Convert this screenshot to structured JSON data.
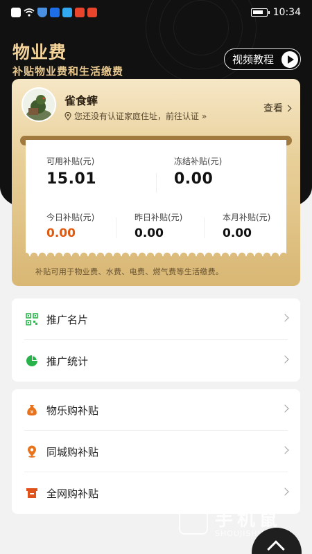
{
  "status_bar": {
    "time": "10:34",
    "icons": [
      "alert-icon",
      "wifi-icon",
      "shield-icon",
      "app-blue-icon",
      "app-sky-icon",
      "weibo-icon",
      "weibo-icon-2"
    ]
  },
  "header": {
    "title": "物业费",
    "subtitle": "补贴物业费和生活缴费",
    "video_button": "视频教程"
  },
  "user": {
    "name": "雀食蟀",
    "auth_hint": "您还没有认证家庭住址，前往认证",
    "view_label": "查看"
  },
  "subsidy": {
    "available_label": "可用补贴(元)",
    "available_value": "15.01",
    "frozen_label": "冻结补贴(元)",
    "frozen_value": "0.00",
    "today_label": "今日补贴(元)",
    "today_value": "0.00",
    "yesterday_label": "昨日补贴(元)",
    "yesterday_value": "0.00",
    "month_label": "本月补贴(元)",
    "month_value": "0.00",
    "note": "补贴可用于物业费、水费、电费、燃气费等生活缴费。"
  },
  "menu_group_1": [
    {
      "label": "推广名片",
      "icon": "qrcode-icon"
    },
    {
      "label": "推广统计",
      "icon": "pie-chart-icon"
    }
  ],
  "menu_group_2": [
    {
      "label": "物乐购补贴",
      "icon": "money-bag-icon"
    },
    {
      "label": "同城购补贴",
      "icon": "location-pin-icon"
    },
    {
      "label": "全网购补贴",
      "icon": "store-icon"
    }
  ],
  "watermark": {
    "text": "手机鼠",
    "sub": "SHOUJISHU.COM"
  },
  "colors": {
    "accent_gold": "#f3d39a",
    "orange": "#e05a10",
    "hero_bg": "#111111"
  }
}
